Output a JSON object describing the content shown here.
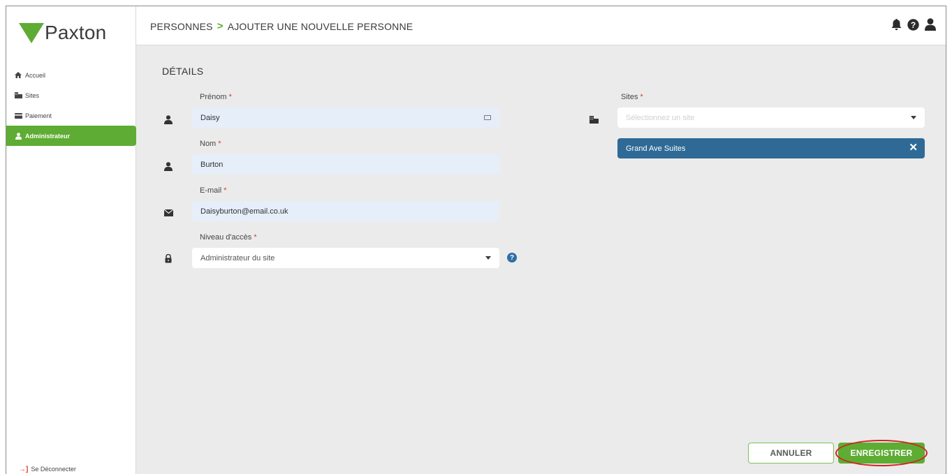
{
  "app": {
    "logo_text": "Paxton"
  },
  "sidebar": {
    "items": [
      {
        "label": "Accueil",
        "icon": "home-icon"
      },
      {
        "label": "Sites",
        "icon": "building-icon"
      },
      {
        "label": "Paiement",
        "icon": "credit-card-icon"
      },
      {
        "label": "Administrateur",
        "icon": "user-icon",
        "active": true
      }
    ],
    "logout_label": "Se Déconnecter"
  },
  "header": {
    "breadcrumb": [
      "PERSONNES",
      "AJOUTER UNE NOUVELLE PERSONNE"
    ],
    "separator": ">",
    "icons": [
      "bell-icon",
      "help-icon",
      "user-icon"
    ]
  },
  "form": {
    "section_title": "DÉTAILS",
    "required_mark": "*",
    "first_name": {
      "label": "Prénom",
      "value": "Daisy"
    },
    "last_name": {
      "label": "Nom",
      "value": "Burton"
    },
    "email": {
      "label": "E-mail",
      "value": "Daisyburton@email.co.uk"
    },
    "access_level": {
      "label": "Niveau d'accès",
      "value": "Administrateur du site"
    },
    "sites": {
      "label": "Sites",
      "placeholder": "Sélectionnez un site",
      "selected": [
        {
          "label": "Grand Ave Suites"
        }
      ]
    }
  },
  "actions": {
    "cancel_label": "ANNULER",
    "save_label": "ENREGISTRER"
  },
  "colors": {
    "brand_green": "#5eac33",
    "chip_blue": "#2f6a96",
    "required_red": "#d83a2e",
    "highlight_ring": "#d42020"
  }
}
